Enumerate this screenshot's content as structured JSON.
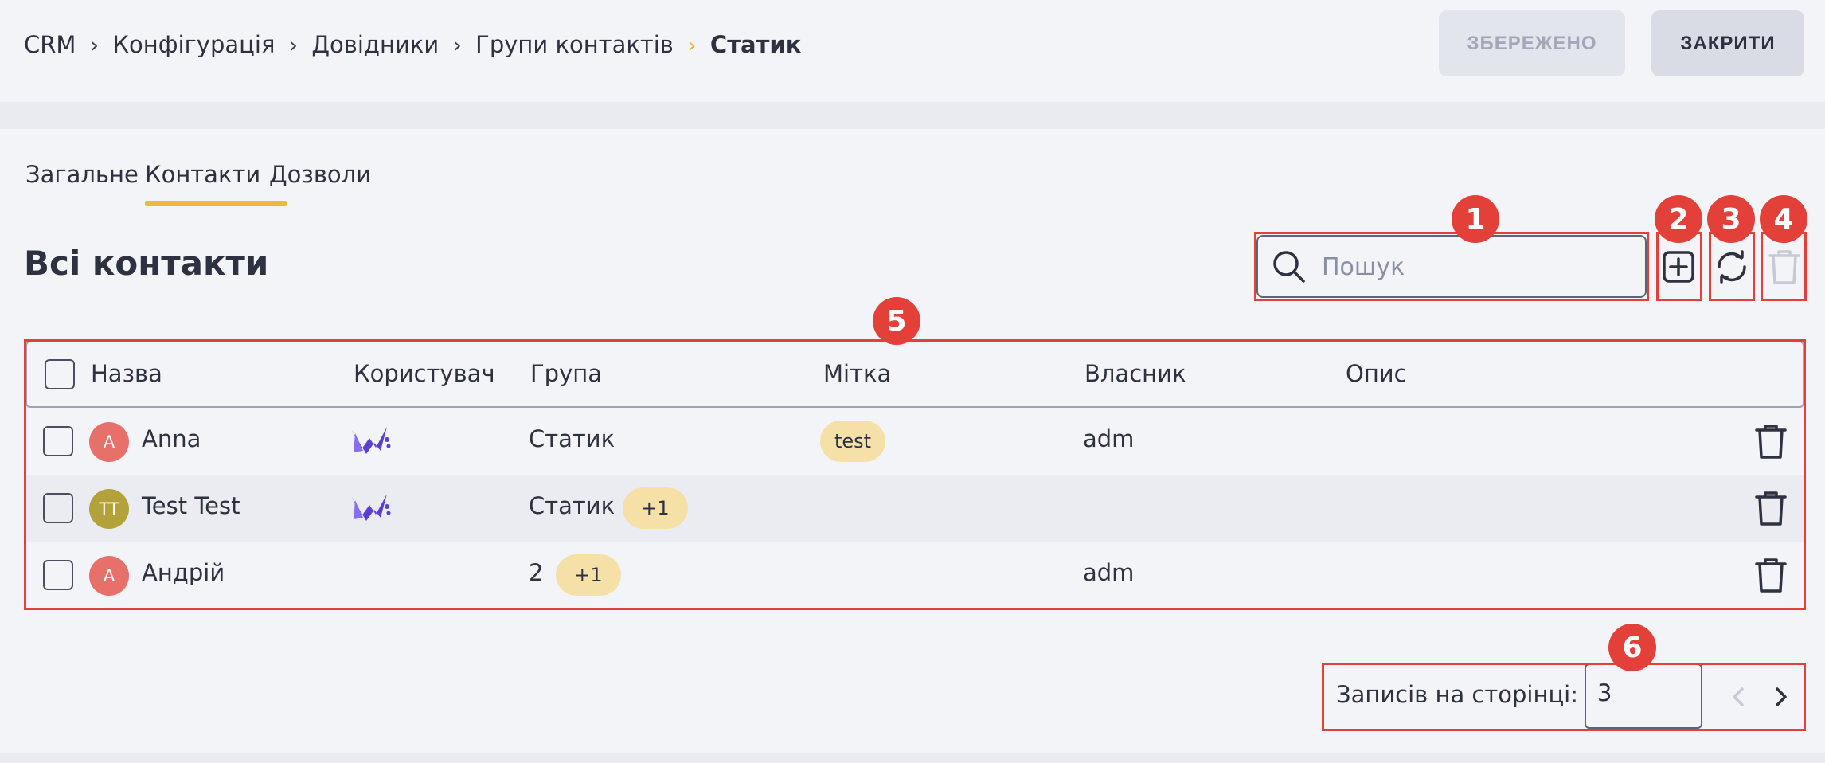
{
  "breadcrumb": [
    {
      "label": "CRM"
    },
    {
      "label": "Конфігурація"
    },
    {
      "label": "Довідники"
    },
    {
      "label": "Групи контактів"
    },
    {
      "label": "Статик"
    }
  ],
  "header_buttons": {
    "saved_label": "ЗБЕРЕЖЕНО",
    "close_label": "ЗАКРИТИ"
  },
  "tabs": [
    {
      "label": "Загальне"
    },
    {
      "label": "Контакти",
      "active": true
    },
    {
      "label": "Дозволи"
    }
  ],
  "section_title": "Всі контакти",
  "search": {
    "placeholder": "Пошук",
    "value": ""
  },
  "table": {
    "columns": [
      "Назва",
      "Користувач",
      "Група",
      "Мітка",
      "Власник",
      "Опис"
    ],
    "rows": [
      {
        "initials": "A",
        "avatar_color": "#e8706a",
        "name": "Anna",
        "user_icon": "webitel-logo-icon",
        "group": "Статик",
        "group_extra": "",
        "tag": "test",
        "owner": "adm",
        "description": ""
      },
      {
        "initials": "TT",
        "avatar_color": "#b3a13a",
        "name": "Test Test",
        "user_icon": "webitel-logo-icon",
        "group": "Статик",
        "group_extra": "+1",
        "tag": "",
        "owner": "",
        "description": ""
      },
      {
        "initials": "A",
        "avatar_color": "#e8706a",
        "name": "Андрій",
        "user_icon": "",
        "group": "2",
        "group_extra": "+1",
        "tag": "",
        "owner": "adm",
        "description": ""
      }
    ]
  },
  "pagination": {
    "label": "Записів на сторінці:",
    "per_page": "3"
  },
  "annotations": [
    "1",
    "2",
    "3",
    "4",
    "5",
    "6"
  ],
  "colors": {
    "accent": "#f2b63c",
    "annotation": "#e3403a",
    "badge": "#f5e1a7"
  }
}
